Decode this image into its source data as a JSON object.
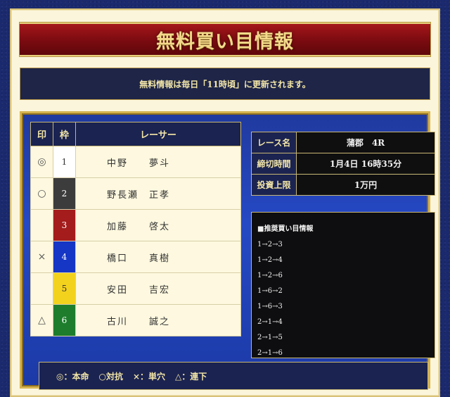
{
  "title": "無料買い目情報",
  "notice": "無料情報は毎日「11時頃」に更新されます。",
  "table": {
    "headers": [
      "印",
      "枠",
      "レーサー"
    ],
    "rows": [
      {
        "mark": "◎",
        "frame": "1",
        "name": "中野　　夢斗"
      },
      {
        "mark": "○",
        "frame": "2",
        "name": "野長瀬　正孝"
      },
      {
        "mark": "",
        "frame": "3",
        "name": "加藤　　啓太"
      },
      {
        "mark": "×",
        "frame": "4",
        "name": "橋口　　真樹"
      },
      {
        "mark": "",
        "frame": "5",
        "name": "安田　　吉宏"
      },
      {
        "mark": "△",
        "frame": "6",
        "name": "古川　　誠之"
      }
    ]
  },
  "info": {
    "race_label": "レース名",
    "race_value": "蒲郡　4R",
    "deadline_label": "締切時間",
    "deadline_value": "1月4日 16時35分",
    "limit_label": "投資上限",
    "limit_value": "1万円"
  },
  "recommend": {
    "heading": "■推奨買い目情報",
    "combos": [
      "1→2→3",
      "1→2→4",
      "1→2→6",
      "1→6→2",
      "1→6→3",
      "2→1→4",
      "2→1→5",
      "2→1→6"
    ]
  },
  "legend": [
    "◎：本命",
    "○対抗",
    "×：単穴",
    "△：連下"
  ]
}
